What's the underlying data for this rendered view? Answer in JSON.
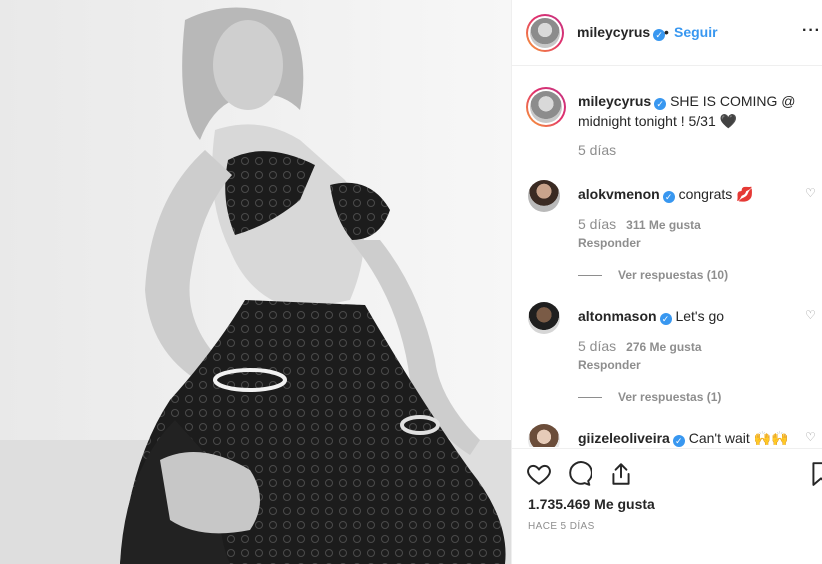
{
  "post": {
    "username": "mileycyrus",
    "verified_mark": "✓",
    "follow_label": "Seguir",
    "more_label": "···",
    "caption": "SHE IS COMING @ midnight tonight ! 5/31 🖤",
    "caption_time": "5 días"
  },
  "comments": [
    {
      "username": "alokvmenon",
      "text": "congrats 💋",
      "time": "5 días",
      "likes": "311 Me gusta",
      "reply_label": "Responder",
      "replies_label": "Ver respuestas (10)"
    },
    {
      "username": "altonmason",
      "text": "Let's go",
      "time": "5 días",
      "likes": "276 Me gusta",
      "reply_label": "Responder",
      "replies_label": "Ver respuestas (1)"
    },
    {
      "username": "giizeleoliveira",
      "text": "Can't wait 🙌🙌",
      "time": "",
      "likes": "",
      "reply_label": "",
      "replies_label": ""
    }
  ],
  "actions": {
    "like_icon": "heart-icon",
    "comment_icon": "comment-icon",
    "share_icon": "share-icon",
    "save_icon": "bookmark-icon"
  },
  "stats": {
    "likes_total": "1.735.469 Me gusta",
    "posted_ago": "HACE 5 DÍAS"
  },
  "colors": {
    "link_blue": "#3897f0",
    "muted": "#8e8e8e",
    "text": "#262626"
  }
}
